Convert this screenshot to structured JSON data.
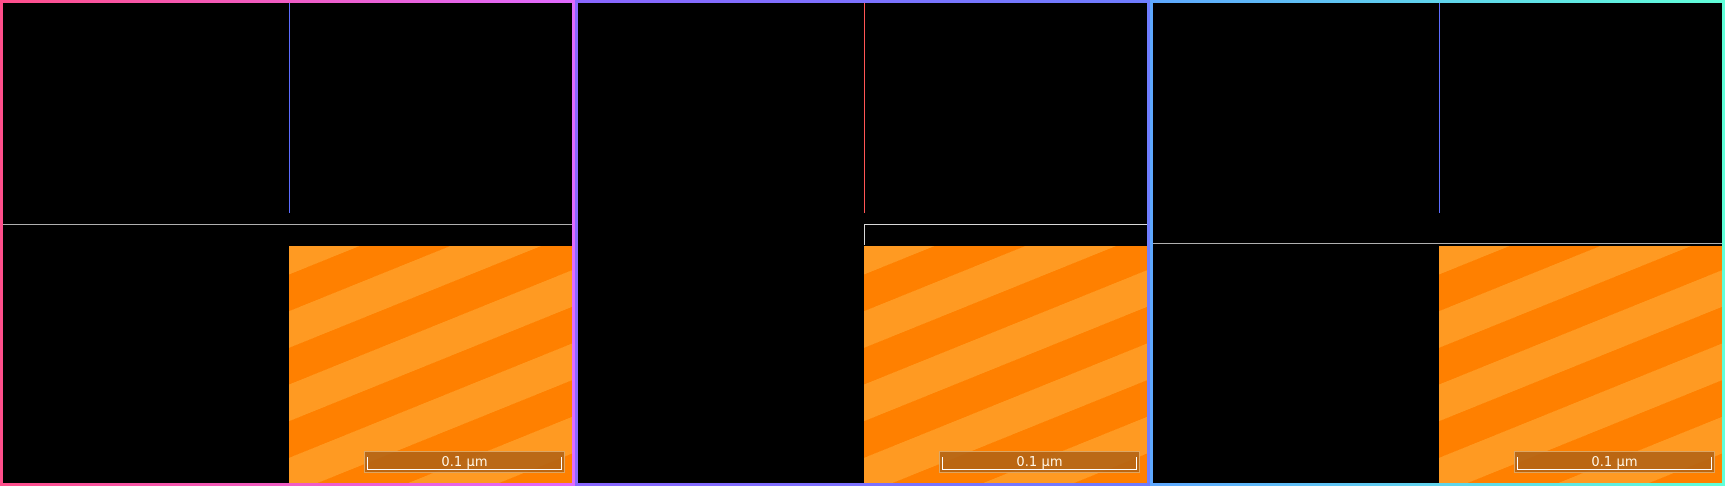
{
  "panels": [
    {
      "id": "left",
      "frame_color": "#ff4f8b",
      "scale_label": "0.1 µm"
    },
    {
      "id": "middle",
      "frame_color": "#8a67ff",
      "scale_label": "0.1 µm"
    },
    {
      "id": "right",
      "frame_color": "#61ffd9",
      "scale_label": "0.1 µm"
    }
  ],
  "colors": {
    "background": "#000000",
    "stripe_dark": "#ff8000",
    "stripe_light": "#ff9a22",
    "line_blue": "#5d6dff",
    "line_red": "#ff5555",
    "line_cyan": "#7ff5ff",
    "line_gray": "#b0b0b0"
  }
}
